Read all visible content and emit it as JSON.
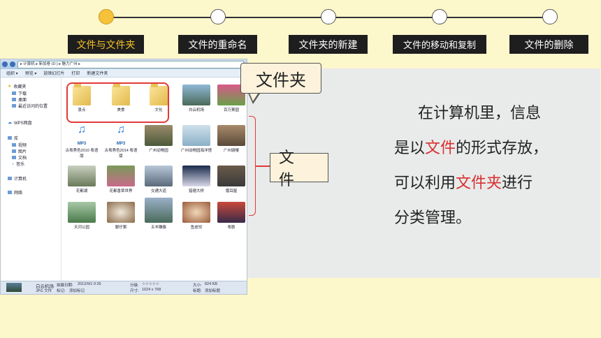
{
  "steps": [
    "文件与文件夹",
    "文件的重命名",
    "文件夹的新建",
    "文件的移动和复制",
    "文件的删除"
  ],
  "explorer": {
    "path": "▸ 计算机 ▸ 新加卷 (D:) ▸ 魅力广州 ▸",
    "toolbar": [
      "组织 ▾",
      "预览 ▾",
      "放映幻灯片",
      "打印",
      "新建文件夹"
    ],
    "nav": {
      "favorites": "收藏夹",
      "download": "下载",
      "desktop": "桌面",
      "recent": "最近访问的位置",
      "wps": "WPS网盘",
      "libraries": "库",
      "video": "视频",
      "pictures": "图片",
      "docs": "文档",
      "music": "音乐",
      "computer": "计算机",
      "network": "网络"
    },
    "folders": [
      "景点",
      "美食",
      "文化"
    ],
    "row1_files": [
      "白云机场",
      "百万葵园"
    ],
    "mp3_label": "MP3",
    "row2": [
      "古粤秀色2010 粤语版",
      "古粤秀色2014 粤语版",
      "广州动物园",
      "广州动物园海洋馆",
      "广州骑楼"
    ],
    "row3": [
      "花都湖",
      "花都香草世界",
      "交通大道",
      "猎德大桥",
      "镬耳屋"
    ],
    "row4": [
      "天河公园",
      "銀仔粥",
      "五羊雕像",
      "鱼皮饺",
      "粤剧"
    ],
    "status": {
      "name": "白云机场",
      "type": "JPG 文件",
      "date_label": "拍摄日期:",
      "date": "2012/9/1 0:35",
      "tag_label": "标记:",
      "tag": "添加标记",
      "rating_label": "分级:",
      "rating": "☆☆☆☆☆",
      "dim_label": "尺寸:",
      "dim": "1024 x 768",
      "size_label": "大小:",
      "size": "824 KB",
      "title_label": "标题:",
      "title": "添加标题"
    }
  },
  "callouts": {
    "folder": "文件夹",
    "file": "文 件"
  },
  "paragraph": {
    "line1": "在计算机里，信息",
    "line2_pre": "是以",
    "line2_red": "文件",
    "line2_post": "的形式存放，",
    "line3_pre": "可以利用",
    "line3_red": "文件夹",
    "line3_post": "进行",
    "line4": "分类管理。"
  },
  "colors": {
    "accent": "#f4c025",
    "highlight": "#e23a3a"
  }
}
